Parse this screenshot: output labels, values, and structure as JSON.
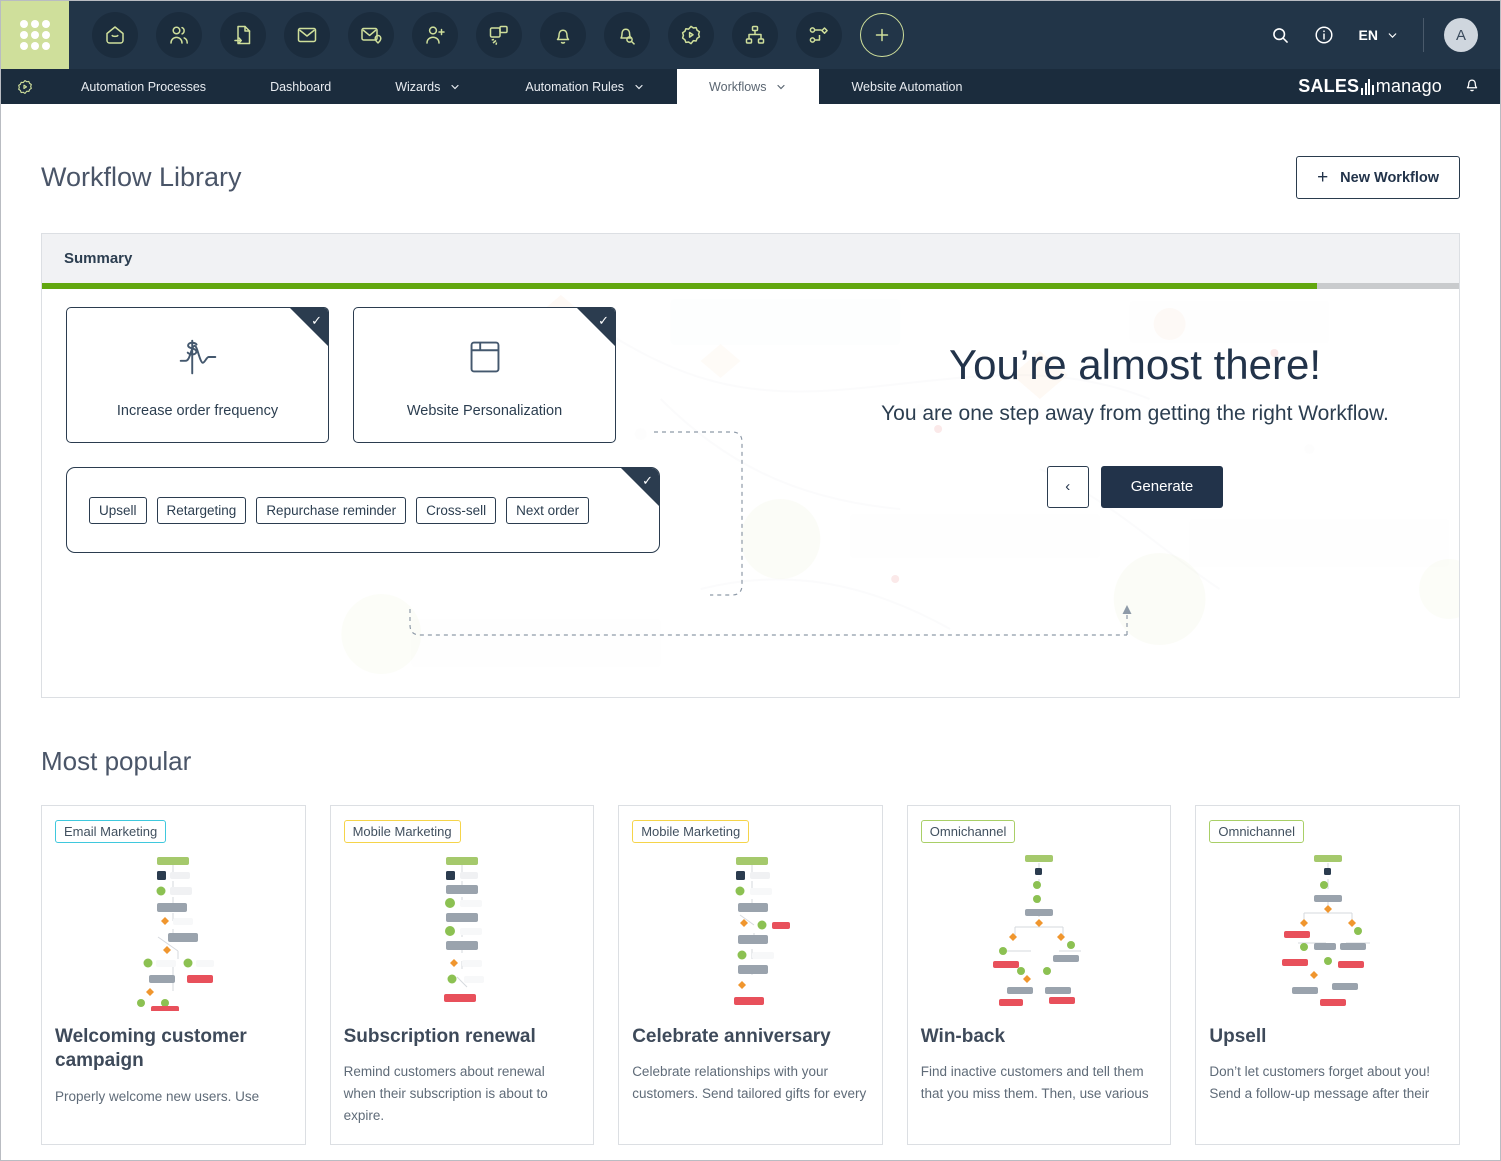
{
  "topnav": {
    "app_grid_label": "apps-grid",
    "icons": [
      {
        "name": "home-icon",
        "title": "Home"
      },
      {
        "name": "contacts-icon",
        "title": "Contacts"
      },
      {
        "name": "document-export-icon",
        "title": "Documents"
      },
      {
        "name": "email-icon",
        "title": "Email"
      },
      {
        "name": "email-location-icon",
        "title": "Email Location"
      },
      {
        "name": "add-user-icon",
        "title": "Add Contact"
      },
      {
        "name": "web-push-icon",
        "title": "Web Push"
      },
      {
        "name": "bell-icon",
        "title": "Notifications"
      },
      {
        "name": "bell-search-icon",
        "title": "Alerts"
      },
      {
        "name": "gear-play-icon",
        "title": "Automation"
      },
      {
        "name": "sitemap-icon",
        "title": "Structure"
      },
      {
        "name": "workflow-icon",
        "title": "Workflows"
      },
      {
        "name": "plus-icon",
        "title": "Add"
      }
    ],
    "search_label": "search-icon",
    "info_label": "info-icon",
    "language": "EN",
    "avatar_initial": "A"
  },
  "tabbar": {
    "gear_icon": "settings-gear-icon",
    "tabs": [
      {
        "label": "Automation Processes",
        "caret": "",
        "active": false
      },
      {
        "label": "Dashboard",
        "caret": "",
        "active": false
      },
      {
        "label": "Wizards",
        "caret": "⌄",
        "active": false
      },
      {
        "label": "Automation Rules",
        "caret": "⌄",
        "active": false
      },
      {
        "label": "Workflows",
        "caret": "⌄",
        "active": true
      },
      {
        "label": "Website Automation",
        "caret": "",
        "active": false
      }
    ],
    "brand_left": "SALES",
    "brand_right": "manago",
    "notification_icon": "bell-icon"
  },
  "header": {
    "title": "Workflow Library",
    "new_workflow_button": "New Workflow",
    "plus": "+"
  },
  "summary": {
    "heading": "Summary",
    "progress_percent": 90,
    "tiles": [
      {
        "label": "Increase order frequency",
        "icon": "dollar-wave-icon",
        "checked": true
      },
      {
        "label": "Website Personalization",
        "icon": "browser-window-icon",
        "checked": true
      }
    ],
    "chips": [
      "Upsell",
      "Retargeting",
      "Repurchase reminder",
      "Cross-sell",
      "Next order"
    ],
    "chips_checked": true,
    "promo_title": "You’re almost there!",
    "promo_subtitle": "You are one step away from getting the right Workflow.",
    "back_button": "‹",
    "generate_button": "Generate"
  },
  "most_popular": {
    "title": "Most popular",
    "cards": [
      {
        "badge": "Email Marketing",
        "badge_type": "email",
        "title": "Welcoming customer campaign",
        "description": "Properly welcome new users. Use"
      },
      {
        "badge": "Mobile Marketing",
        "badge_type": "mobile",
        "title": "Subscription renewal",
        "description": "Remind customers about renewal when their subscription is about to expire."
      },
      {
        "badge": "Mobile Marketing",
        "badge_type": "mobile",
        "title": "Celebrate anniversary",
        "description": "Celebrate relationships with your customers. Send tailored gifts for every"
      },
      {
        "badge": "Omnichannel",
        "badge_type": "omni",
        "title": "Win-back",
        "description": "Find inactive customers and tell them that you miss them. Then, use various"
      },
      {
        "badge": "Omnichannel",
        "badge_type": "omni",
        "title": "Upsell",
        "description": "Don’t let customers forget about you! Send a follow-up message after their"
      }
    ]
  },
  "colors": {
    "navy": "#223548",
    "navy_dark": "#1b2c3d",
    "accent_green": "#cfdf9b",
    "progress_green": "#62a70f",
    "badge_email": "#3fc8dd",
    "badge_mobile": "#f5d44a",
    "badge_omni": "#a9cf67"
  }
}
